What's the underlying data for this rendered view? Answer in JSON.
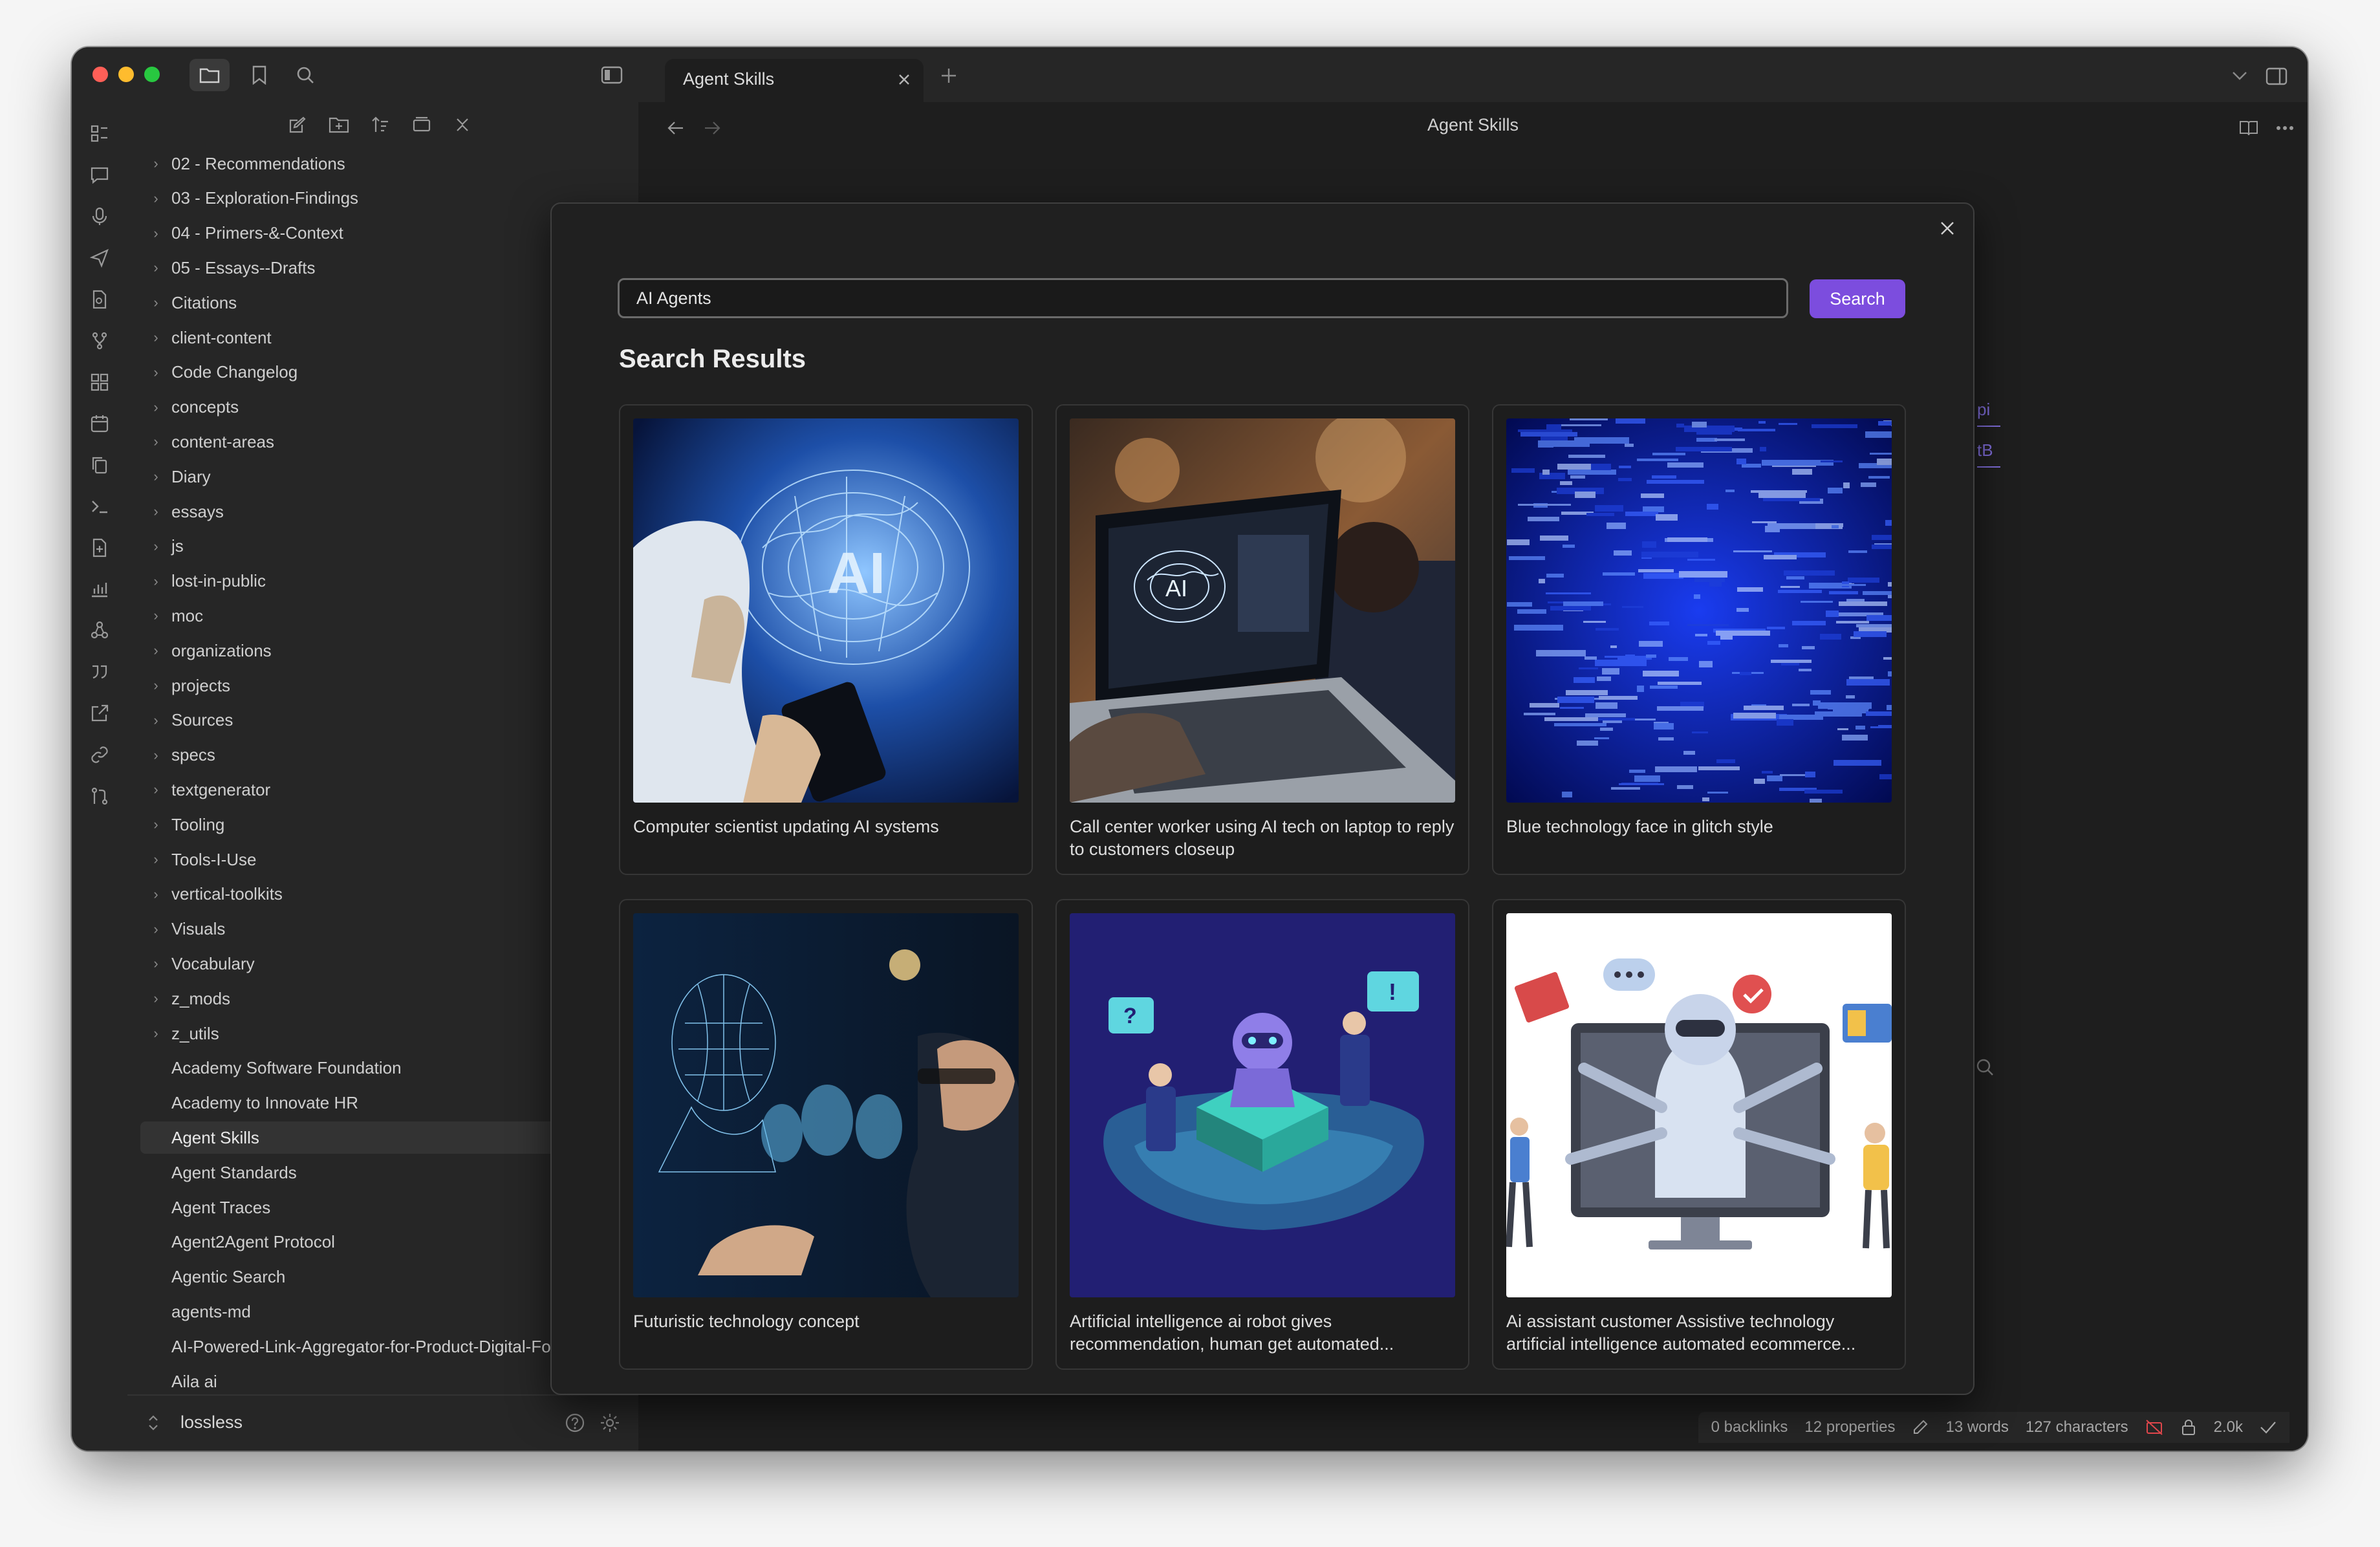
{
  "window": {
    "tab_title": "Agent Skills",
    "note_title": "Agent Skills"
  },
  "colors": {
    "accent": "#7c4dde",
    "traffic_close": "#ff5f57",
    "traffic_min": "#febc2e",
    "traffic_max": "#28c840"
  },
  "titlebar_icons": [
    "folder-icon",
    "bookmark-icon",
    "search-icon",
    "sidebar-toggle-icon",
    "new-tab-icon",
    "chevron-down-icon",
    "right-sidebar-icon"
  ],
  "ribbon_icons": [
    "dashboard-icon",
    "comment-icon",
    "microphone-icon",
    "send-icon",
    "file-search-icon",
    "git-branch-icon",
    "grid-icon",
    "calendar-icon",
    "copy-icon",
    "terminal-icon",
    "new-note-icon",
    "chart-icon",
    "graph-icon",
    "quote-icon",
    "external-link-icon",
    "link-icon",
    "git-compare-icon"
  ],
  "explorer": {
    "toolbar": [
      "new-note-icon",
      "new-folder-icon",
      "sort-icon",
      "collapse-icon",
      "close-icon"
    ],
    "folders": [
      "02 - Recommendations",
      "03 - Exploration-Findings",
      "04 - Primers-&-Context",
      "05 - Essays--Drafts",
      "Citations",
      "client-content",
      "Code Changelog",
      "concepts",
      "content-areas",
      "Diary",
      "essays",
      "js",
      "lost-in-public",
      "moc",
      "organizations",
      "projects",
      "Sources",
      "specs",
      "textgenerator",
      "Tooling",
      "Tools-I-Use",
      "vertical-toolkits",
      "Visuals",
      "Vocabulary",
      "z_mods",
      "z_utils"
    ],
    "files": [
      "Academy Software Foundation",
      "Academy to Innovate HR",
      "Agent Skills",
      "Agent Standards",
      "Agent Traces",
      "Agent2Agent Protocol",
      "Agentic Search",
      "agents-md",
      "AI-Powered-Link-Aggregator-for-Product-Digital-Foot...",
      "Aila ai"
    ],
    "active_file": "Agent Skills",
    "vault_name": "lossless"
  },
  "status": {
    "backlinks": "0 backlinks",
    "properties": "12 properties",
    "words": "13 words",
    "characters": "127 characters",
    "size": "2.0k"
  },
  "modal": {
    "search_value": "AI Agents",
    "search_button": "Search",
    "results_title": "Search Results",
    "results": [
      {
        "caption": "Computer scientist updating AI systems",
        "image": "ai-brain-scientist"
      },
      {
        "caption": "Call center worker using AI tech on laptop to reply to customers closeup",
        "image": "laptop-ai-brain"
      },
      {
        "caption": "Blue technology face in glitch style",
        "image": "blue-glitch"
      },
      {
        "caption": "Futuristic technology concept",
        "image": "wireframe-faces"
      },
      {
        "caption": "Artificial intelligence ai robot gives recommendation, human get automated...",
        "image": "isometric-robot"
      },
      {
        "caption": "Ai assistant customer Assistive technology artificial intelligence automated ecommerce...",
        "image": "robot-monitor"
      }
    ]
  }
}
